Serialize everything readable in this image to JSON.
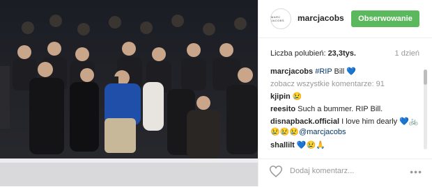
{
  "post": {
    "username": "marcjacobs",
    "avatar_text": "MARC JACOBS",
    "follow_label": "Obserwowanie",
    "likes_prefix": "Liczba polubień: ",
    "likes_count": "23,3tys.",
    "time": "1 dzień"
  },
  "comments": [
    {
      "user": "marcjacobs",
      "text": "Bill 💙",
      "tag": "#RIP"
    },
    {
      "text": "zobacz wszystkie komentarze: 91"
    },
    {
      "user": "kjipin",
      "text": "😢"
    },
    {
      "user": "reesito",
      "text": "Such a bummer. RIP Bill."
    },
    {
      "user": "disnapback.official",
      "text": "I love him dearly 💙🚲"
    },
    {
      "text": "😢😢😢",
      "mention": "@marcjacobs"
    },
    {
      "user": "shallilt",
      "text": "💙😢🙏"
    }
  ],
  "footer": {
    "placeholder": "Dodaj komentarz...",
    "more": "•••"
  },
  "colors": {
    "follow": "#5cb85c",
    "link": "#003569"
  }
}
